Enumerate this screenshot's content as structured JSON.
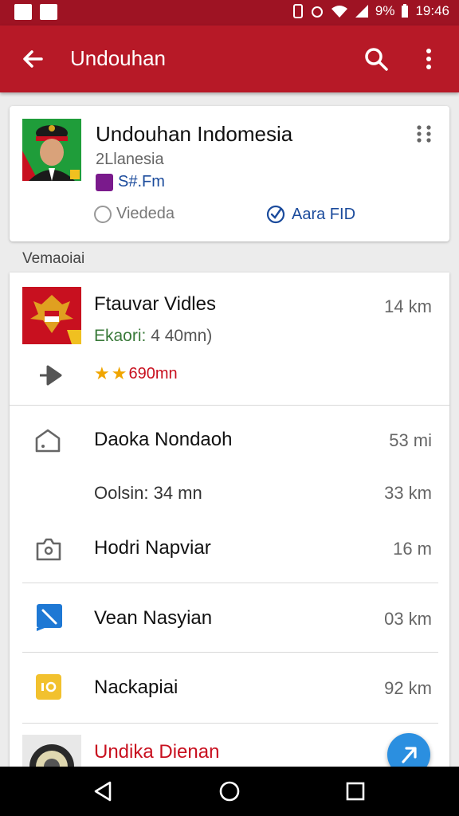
{
  "status_bar": {
    "battery": "9%",
    "time": "19:46"
  },
  "app_bar": {
    "title": "Undouhan"
  },
  "top_card": {
    "title": "Undouhan Indomesia",
    "subtitle": "2Llanesia",
    "tag": "S#.Fm",
    "radio_option": "Viededa",
    "check_option": "Aara FID"
  },
  "section_label": "Vemaoiai",
  "featured": {
    "title": "Ftauvar Vidles",
    "distance": "14 km",
    "detail_prefix": "Ekaori:",
    "detail_value": "4 40mn)",
    "rating_text": "690mn",
    "stars": 2
  },
  "rows": [
    {
      "title": "Daoka Nondaoh",
      "distance": "53 mi",
      "icon": "home-icon"
    },
    {
      "title": "Oolsin: 34 mn",
      "distance": "33 km",
      "icon": ""
    },
    {
      "title": "Hodri Napviar",
      "distance": "16 m",
      "icon": "camera-icon"
    },
    {
      "title": "Vean Nasyian",
      "distance": "03 km",
      "icon": "edit-icon"
    },
    {
      "title": "Nackapiai",
      "distance": "92 km",
      "icon": "badge-icon"
    },
    {
      "title": "Undika Dienan",
      "distance": "",
      "icon": "seal-icon"
    }
  ],
  "colors": {
    "primary": "#b71927",
    "status": "#9e1323",
    "accent_blue": "#1b4b9c",
    "fab": "#2b8fe0",
    "star": "#f0a500"
  }
}
